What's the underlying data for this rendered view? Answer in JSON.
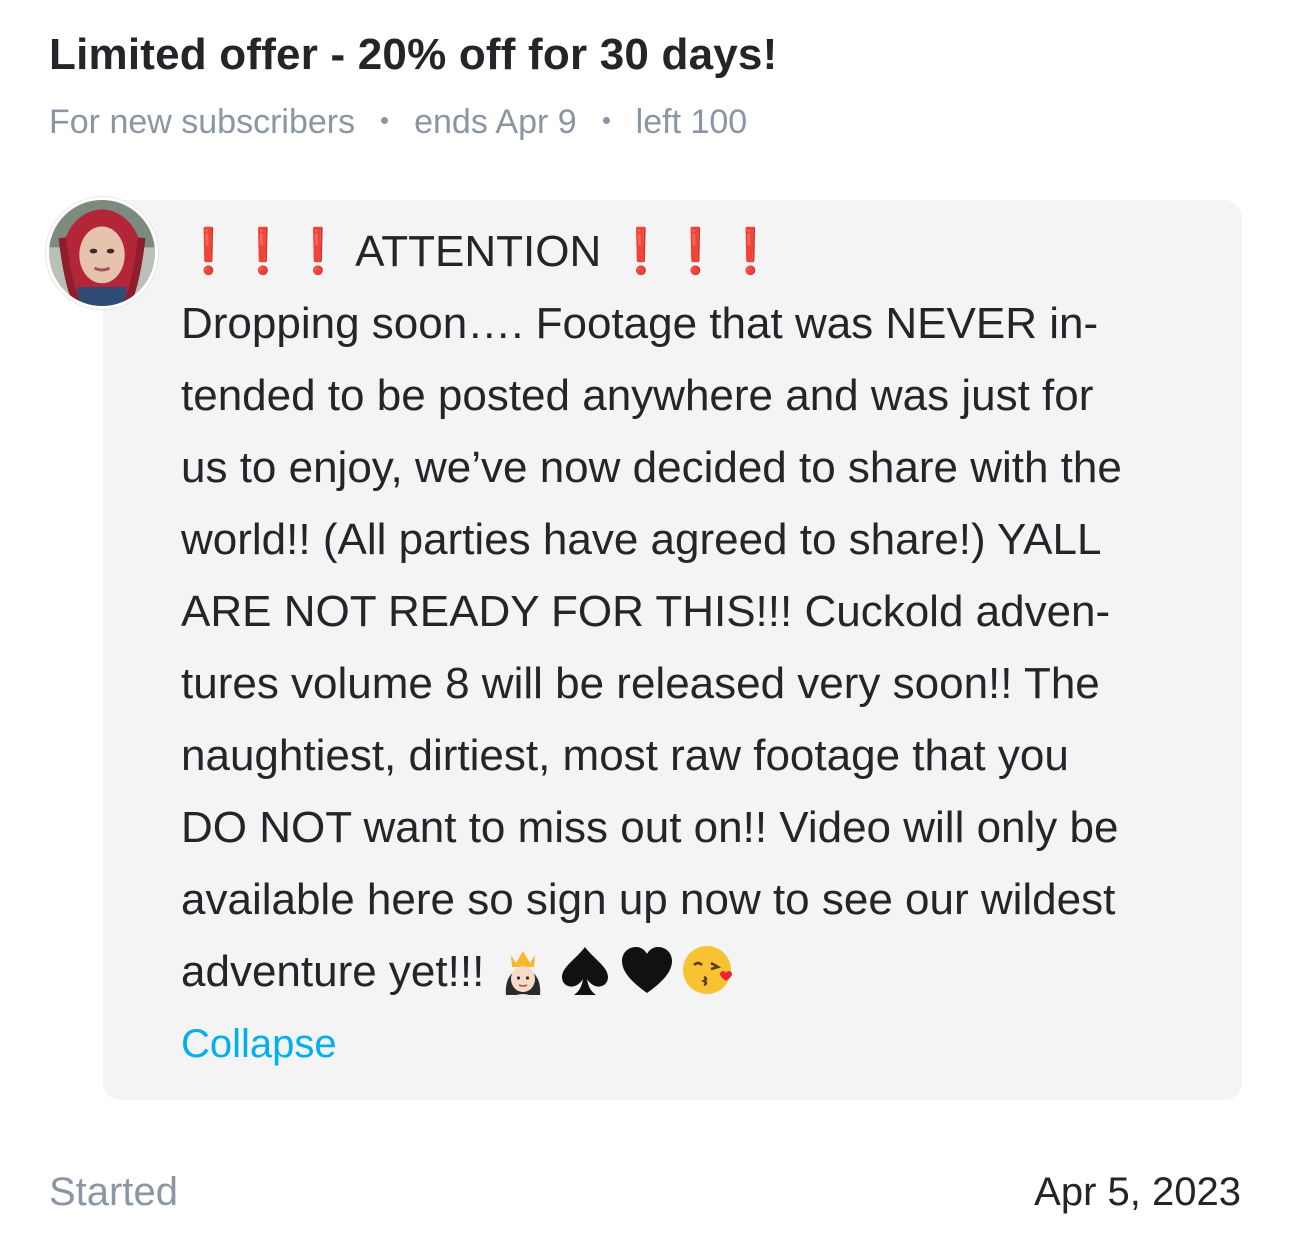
{
  "offer": {
    "title": "Limited offer - 20% off for 30 days!",
    "audience": "For new subscribers",
    "ends": "ends Apr 9",
    "remaining": "left 100"
  },
  "message": {
    "heading_prefix": "❗️❗️❗️",
    "heading_word": "ATTENTION",
    "heading_suffix": "❗️❗️❗️",
    "lines": [
      "Dropping soon…. Footage that was NEVER in-",
      "tended to be posted anywhere and was just for",
      "us to enjoy, we’ve now decided to share with the",
      "world!! (All parties have agreed to share!) YALL",
      "ARE NOT READY FOR THIS!!! Cuckold adven-",
      "tures volume 8 will be released very soon!! The",
      "naughtiest, dirtiest, most raw footage that you",
      "DO NOT want to miss out on!! Video will only be",
      "available here so sign up now to see our wildest"
    ],
    "last_line": "adventure yet!!!",
    "emojis": [
      "princess-emoji",
      "spade-emoji",
      "black-heart-emoji",
      "kissing-face-emoji"
    ],
    "collapse_label": "Collapse"
  },
  "footer": {
    "started_label": "Started",
    "started_date": "Apr 5, 2023"
  },
  "colors": {
    "accent": "#00aff0",
    "muted": "#8a96a3",
    "text": "#242429",
    "bubble": "#f4f4f5",
    "alert": "#e0121a"
  }
}
